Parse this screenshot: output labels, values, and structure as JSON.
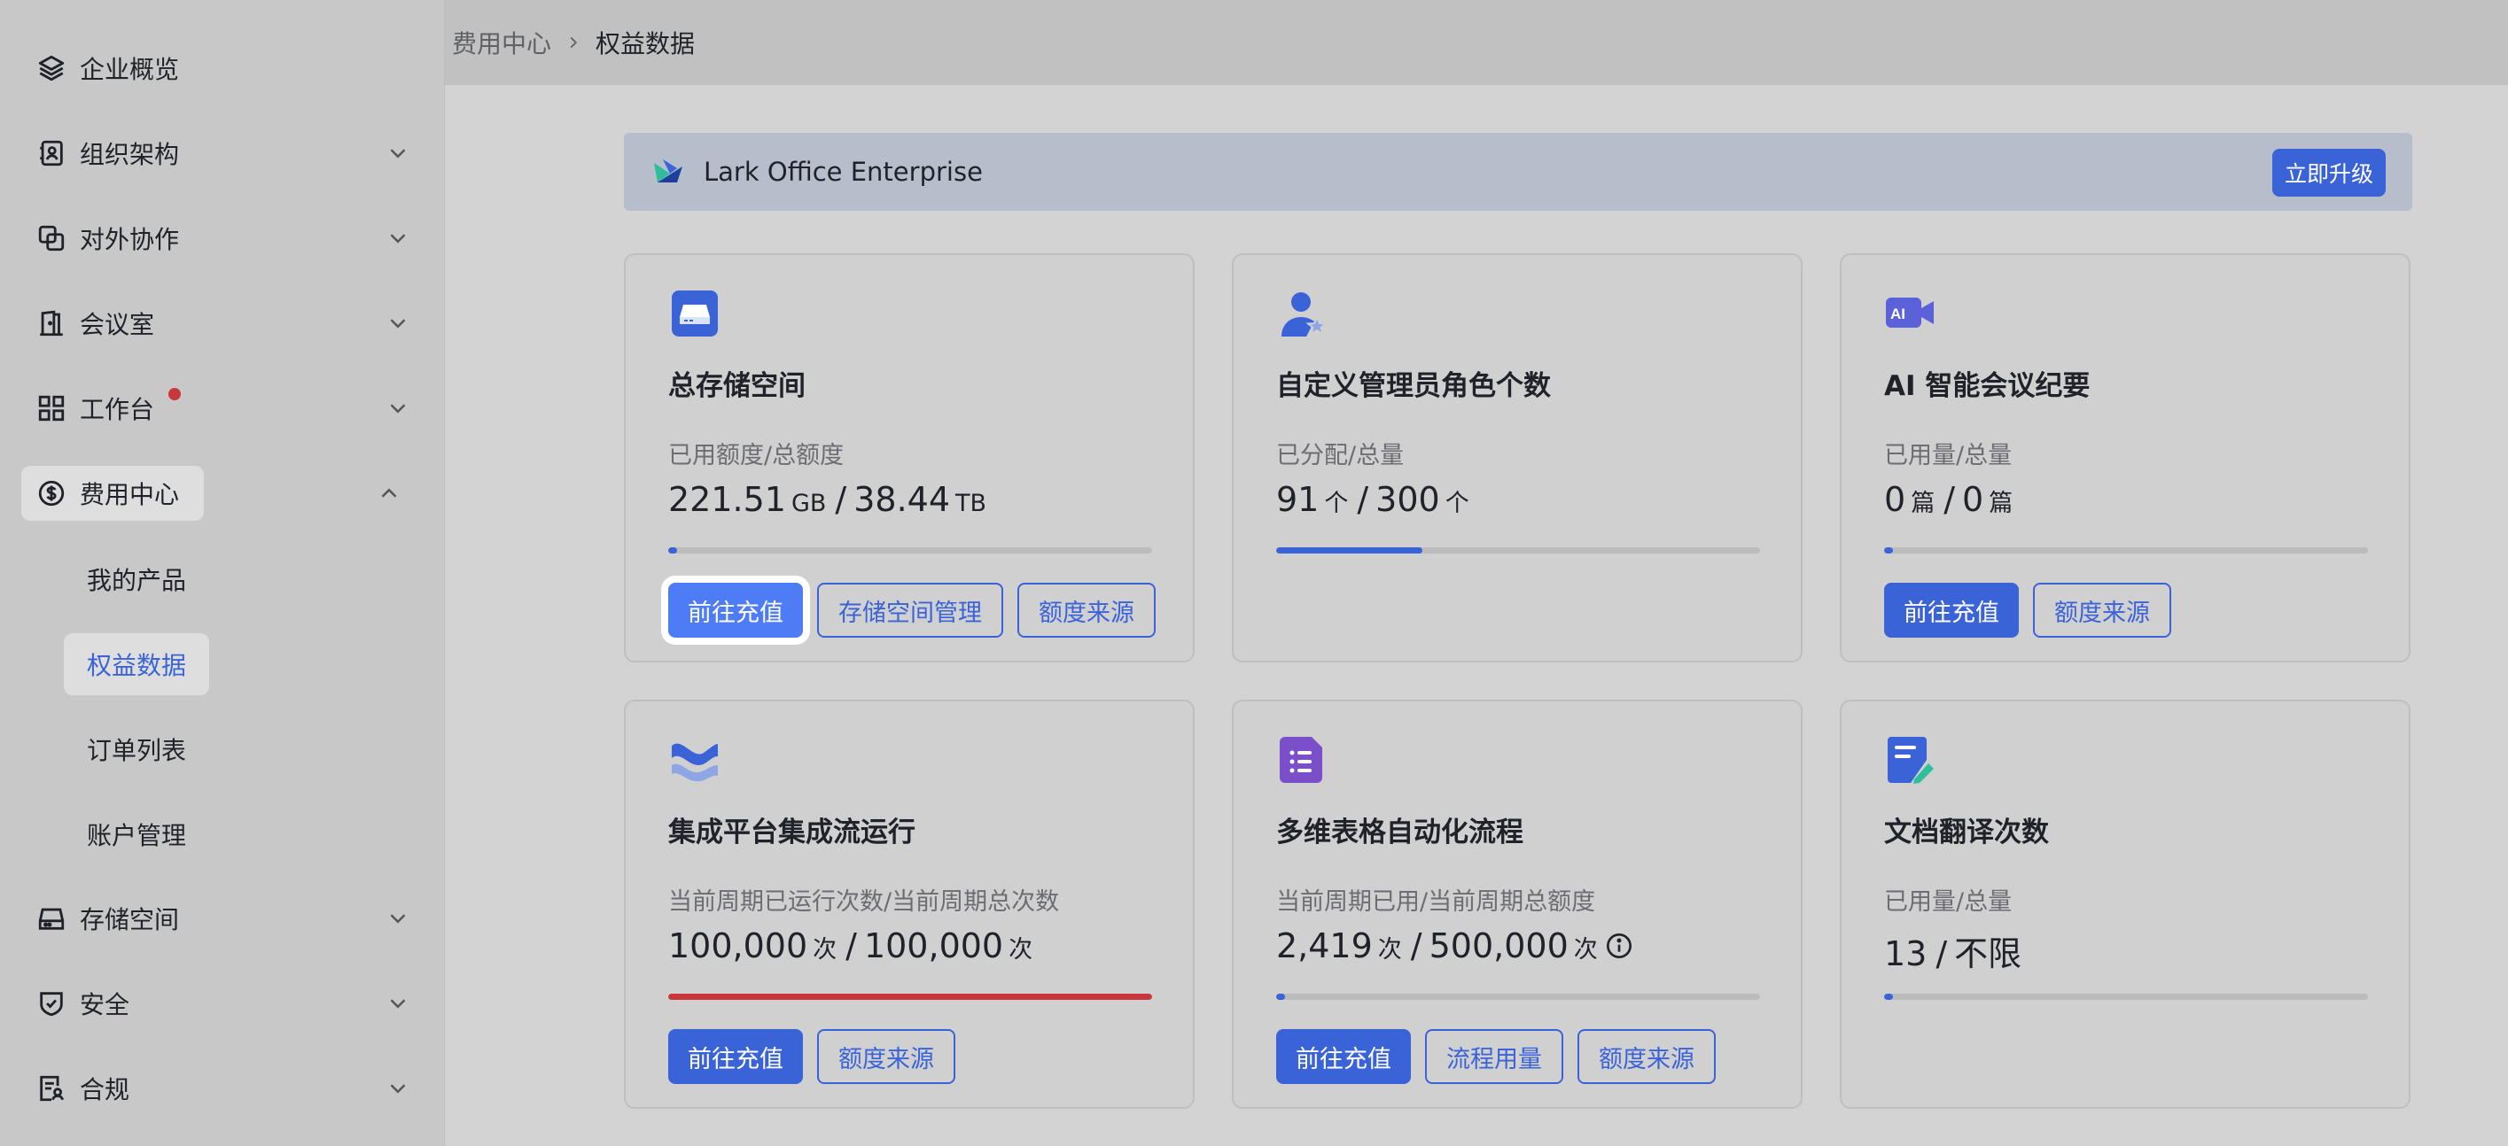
{
  "sidebar": {
    "items": [
      {
        "label": "企业概览",
        "icon": "layers-icon"
      },
      {
        "label": "组织架构",
        "icon": "contacts-icon"
      },
      {
        "label": "对外协作",
        "icon": "collaboration-icon"
      },
      {
        "label": "会议室",
        "icon": "door-icon"
      },
      {
        "label": "工作台",
        "icon": "grid-icon"
      },
      {
        "label": "费用中心",
        "icon": "dollar-icon"
      },
      {
        "label": "存储空间",
        "icon": "drive-icon"
      },
      {
        "label": "安全",
        "icon": "shield-icon"
      },
      {
        "label": "合规",
        "icon": "compliance-icon"
      }
    ],
    "subitems": [
      "我的产品",
      "权益数据",
      "订单列表",
      "账户管理"
    ]
  },
  "breadcrumb": {
    "parent": "费用中心",
    "current": "权益数据"
  },
  "banner": {
    "title": "Lark Office Enterprise",
    "upgrade_label": "立即升级"
  },
  "cards": [
    {
      "icon": "storage-icon",
      "title": "总存储空间",
      "subtitle": "已用额度/总额度",
      "used": "221.51",
      "used_unit": "GB",
      "total": "38.44",
      "total_unit": "TB",
      "progress": 0.006,
      "progress_color": "#3b63d8",
      "buttons": [
        "前往充值",
        "存储空间管理",
        "额度来源"
      ]
    },
    {
      "icon": "admin-role-icon",
      "title": "自定义管理员角色个数",
      "subtitle": "已分配/总量",
      "used": "91",
      "used_unit": "个",
      "total": "300",
      "total_unit": "个",
      "progress": 0.303,
      "progress_color": "#3b63d8",
      "buttons": []
    },
    {
      "icon": "ai-meeting-icon",
      "title": "AI 智能会议纪要",
      "subtitle": "已用量/总量",
      "used": "0",
      "used_unit": "篇",
      "total": "0",
      "total_unit": "篇",
      "progress": 0.005,
      "progress_color": "#3b63d8",
      "buttons": [
        "前往充值",
        "额度来源"
      ]
    },
    {
      "icon": "integration-icon",
      "title": "集成平台集成流运行",
      "subtitle": "当前周期已运行次数/当前周期总次数",
      "used": "100,000",
      "used_unit": "次",
      "total": "100,000",
      "total_unit": "次",
      "progress": 1.0,
      "progress_color": "#c8373c",
      "buttons": [
        "前往充值",
        "额度来源"
      ]
    },
    {
      "icon": "base-automation-icon",
      "title": "多维表格自动化流程",
      "subtitle": "当前周期已用/当前周期总额度",
      "used": "2,419",
      "used_unit": "次",
      "total": "500,000",
      "total_unit": "次",
      "progress": 0.005,
      "progress_color": "#3b63d8",
      "buttons": [
        "前往充值",
        "流程用量",
        "额度来源"
      ]
    },
    {
      "icon": "doc-translate-icon",
      "title": "文档翻译次数",
      "subtitle": "已用量/总量",
      "used": "13",
      "used_unit": "",
      "total": "不限",
      "total_unit": "",
      "progress": 0.005,
      "progress_color": "#3b63d8",
      "buttons": []
    }
  ]
}
